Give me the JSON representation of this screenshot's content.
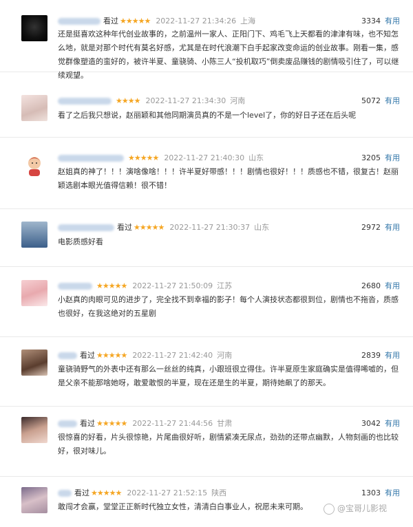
{
  "comments": [
    {
      "status": "看过",
      "stars": "★★★★★",
      "time": "2022-11-27 21:34:26",
      "location": "上海",
      "votes": "3334",
      "useful_label": "有用",
      "content": "还是挺喜欢这种年代创业故事的，之前温州一家人、正阳门下、鸡毛飞上天都看的津津有味，也不知怎么地，就是对那个时代有莫名好感，尤其是在时代浪潮下白手起家改变命运的创业故事。刚看一集，感觉群像塑造的蛮好的，被许半夏、童骁骑、小陈三人“投机取巧”倒卖废品赚钱的剧情吸引住了，可以继续观望。"
    },
    {
      "status": "",
      "stars": "★★★★",
      "time": "2022-11-27 21:34:30",
      "location": "河南",
      "votes": "5072",
      "useful_label": "有用",
      "content": "看了之后我只想说，赵丽颖和其他同期演员真的不是一个level了，你的好日子还在后头呢"
    },
    {
      "status": "",
      "stars": "★★★★★",
      "time": "2022-11-27 21:40:30",
      "location": "山东",
      "votes": "3205",
      "useful_label": "有用",
      "content": "赵姐真的神了！！！演啥像啥！！！许半夏好带感！！！剧情也很好！！！质感也不错，很复古！赵丽颖选剧本眼光值得信赖！很不错！"
    },
    {
      "status": "看过",
      "stars": "★★★★★",
      "time": "2022-11-27 21:30:37",
      "location": "山东",
      "votes": "2972",
      "useful_label": "有用",
      "content": "电影质感好看"
    },
    {
      "status": "",
      "stars": "★★★★★",
      "time": "2022-11-27 21:50:09",
      "location": "江苏",
      "votes": "2680",
      "useful_label": "有用",
      "content": "小赵真的肉眼可见的进步了，完全找不到幸福的影子！每个人演技状态都很到位，剧情也不拖沓，质感也很好，在我这绝对的五星剧"
    },
    {
      "status": "看过",
      "stars": "★★★★★",
      "time": "2022-11-27 21:42:40",
      "location": "河南",
      "votes": "2839",
      "useful_label": "有用",
      "content": "童骁骑野气的外表中还有那么一丝丝的纯真，小跟班很立得住。许半夏原生家庭确实是值得唏嘘的，但是父亲不能那啥她呀，敢爱敢恨的半夏，现在还是生的半夏，期待她飙了的那天。"
    },
    {
      "status": "看过",
      "stars": "★★★★★",
      "time": "2022-11-27 21:44:56",
      "location": "甘肃",
      "votes": "3042",
      "useful_label": "有用",
      "content": "很惊喜的好看，片头很惊艳，片尾曲很好听，剧情紧凑无尿点，劲劲的还带点幽默，人物刻画的也比较好，很对味儿。"
    },
    {
      "status": "看过",
      "stars": "★★★★★",
      "time": "2022-11-27 21:52:15",
      "location": "陕西",
      "votes": "1303",
      "useful_label": "有用",
      "content": "敢闯才会赢，堂堂正正新时代独立女性，清清白白事业人，祝愿未来可期。"
    }
  ],
  "watermark": "@宝哥儿影视"
}
